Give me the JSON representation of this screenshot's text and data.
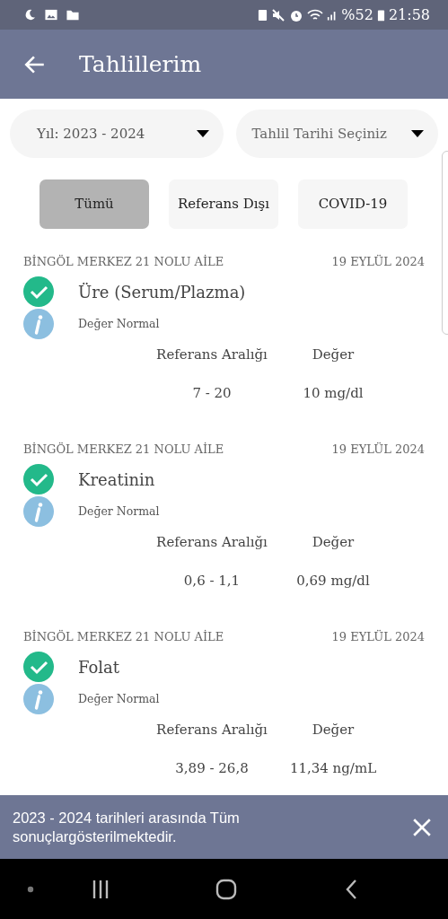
{
  "status_bar": {
    "battery_percent": "%52",
    "time": "21:58"
  },
  "app_bar": {
    "title": "Tahlillerim"
  },
  "dropdowns": [
    {
      "value": "Yıl: 2023 - 2024"
    },
    {
      "placeholder": "Tahlil Tarihi Seçiniz"
    }
  ],
  "filters": [
    {
      "label": "Tümü",
      "selected": true
    },
    {
      "label": "Referans Dışı",
      "selected": false
    },
    {
      "label": "COVID-19",
      "selected": false
    }
  ],
  "results": [
    {
      "institution": "BİNGÖL MERKEZ 21 NOLU AİLE",
      "date": "19 EYLÜL 2024",
      "test": "Üre (Serum/Plazma)",
      "status": "Değer Normal",
      "normal": true,
      "range_label": "Referans Aralığı",
      "value_label": "Değer",
      "range": "7 - 20",
      "value": "10 mg/dl"
    },
    {
      "institution": "BİNGÖL MERKEZ 21 NOLU AİLE",
      "date": "19 EYLÜL 2024",
      "test": "Kreatinin",
      "status": "Değer Normal",
      "normal": true,
      "range_label": "Referans Aralığı",
      "value_label": "Değer",
      "range": "0,6 - 1,1",
      "value": "0,69 mg/dl"
    },
    {
      "institution": "BİNGÖL MERKEZ 21 NOLU AİLE",
      "date": "19 EYLÜL 2024",
      "test": "Folat",
      "status": "Değer Normal",
      "normal": true,
      "range_label": "Referans Aralığı",
      "value_label": "Değer",
      "range": "3,89 - 26,8",
      "value": "11,34 ng/mL"
    }
  ],
  "snackbar": {
    "message": "2023 - 2024 tarihleri arasında Tüm sonuçlargösterilmektedir."
  }
}
